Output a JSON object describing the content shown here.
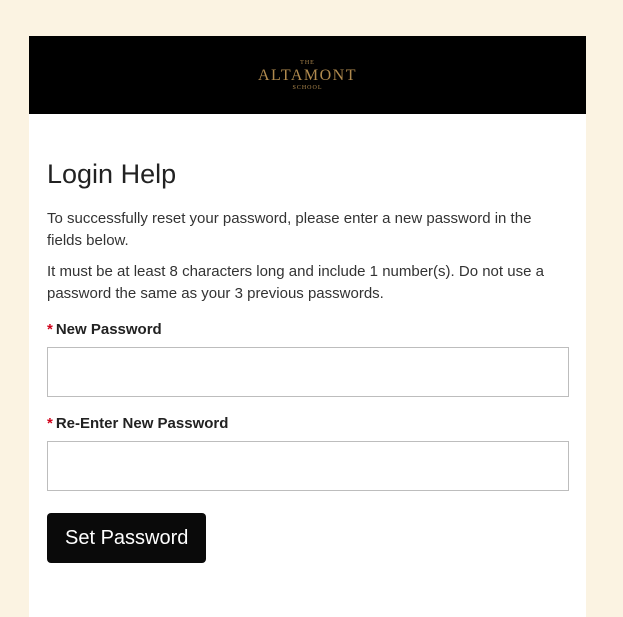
{
  "header": {
    "logo_the": "THE",
    "logo_name": "ALTAMONT",
    "logo_school": "SCHOOL"
  },
  "main": {
    "title": "Login Help",
    "intro": "To successfully reset your password, please enter a new password in the fields below.",
    "rules": "It must be at least 8 characters long and include 1 number(s). Do not use a password the same as your 3 previous passwords.",
    "required_marker": "*",
    "new_password_label": "New Password",
    "new_password_value": "",
    "reenter_password_label": "Re-Enter New Password",
    "reenter_password_value": "",
    "submit_label": "Set Password"
  },
  "colors": {
    "page_background": "#fbf3e2",
    "header_background": "#000000",
    "logo": "#b08a4e",
    "required": "#d0021b",
    "button": "#0a0a0a"
  }
}
